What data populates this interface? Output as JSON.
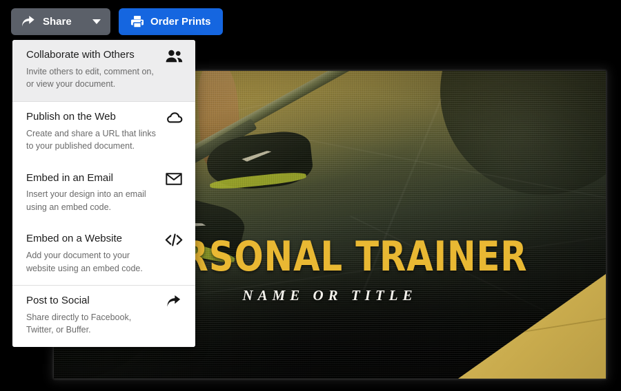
{
  "toolbar": {
    "share_button": {
      "label": "Share",
      "icon": "share-arrow-icon",
      "caret": "chevron-down-icon",
      "background": "#5b6069"
    },
    "order_prints_button": {
      "label": "Order Prints",
      "icon": "printer-icon",
      "background": "#1566e0"
    }
  },
  "share_menu": {
    "items": [
      {
        "title": "Collaborate with Others",
        "description": "Invite others to edit, comment on, or view your document.",
        "icon": "people-icon",
        "active": true,
        "divider_above": false
      },
      {
        "title": "Publish on the Web",
        "description": "Create and share a URL that links to your published document.",
        "icon": "cloud-icon",
        "active": false,
        "divider_above": true
      },
      {
        "title": "Embed in an Email",
        "description": "Insert your design into an email using an embed code.",
        "icon": "envelope-icon",
        "active": false,
        "divider_above": false
      },
      {
        "title": "Embed on a Website",
        "description": "Add your document to your website using an embed code.",
        "icon": "code-brackets-icon",
        "active": false,
        "divider_above": false
      },
      {
        "title": "Post to Social",
        "description": "Share directly to Facebook, Twitter, or Buffer.",
        "icon": "share-arrow-icon",
        "active": false,
        "divider_above": true
      }
    ]
  },
  "poster": {
    "headline": "PERSONAL TRAINER",
    "subheadline": "NAME OR TITLE",
    "headline_color": "#e9b833",
    "subheadline_color": "#f4f2ec",
    "accent_corner_color": "#c9ab4d",
    "photo_description": "gym floor with athlete legs, training shoes and barbell"
  }
}
